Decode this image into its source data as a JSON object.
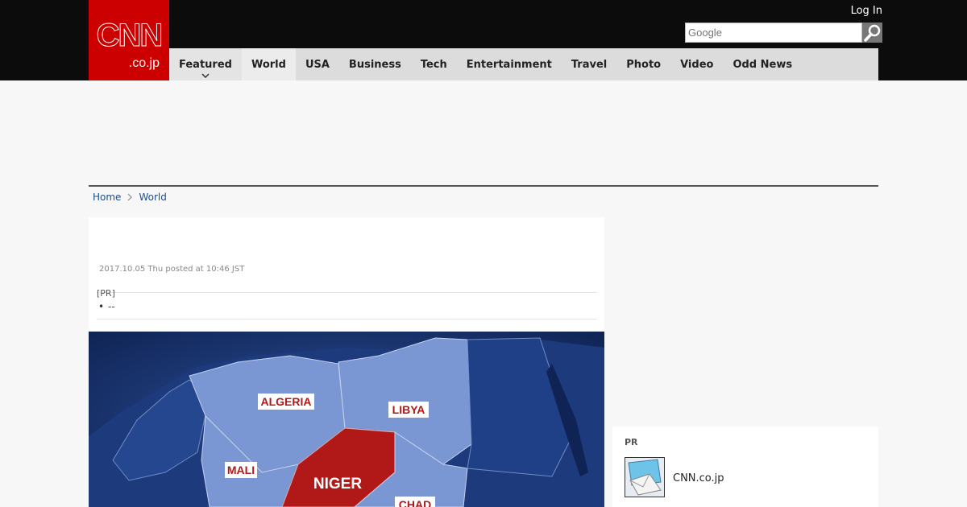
{
  "header": {
    "logo_main": "CNN",
    "logo_sub": ".co.jp",
    "login_label": "Log In",
    "search_placeholder": "Google",
    "brand_color": "#cc0000"
  },
  "nav": {
    "items": [
      {
        "label": "Featured"
      },
      {
        "label": "World"
      },
      {
        "label": "USA"
      },
      {
        "label": "Business"
      },
      {
        "label": "Tech"
      },
      {
        "label": "Entertainment"
      },
      {
        "label": "Travel"
      },
      {
        "label": "Photo"
      },
      {
        "label": "Video"
      },
      {
        "label": "Odd News"
      }
    ]
  },
  "breadcrumb": {
    "home": "Home",
    "current": "World"
  },
  "article": {
    "posted": "2017.10.05 Thu posted at 10:46 JST",
    "pr_label": "[PR]",
    "pr_link": "--",
    "map_labels": {
      "algeria": "ALGERIA",
      "libya": "LIBYA",
      "mali": "MALI",
      "niger": "NIGER",
      "chad": "CHAD"
    }
  },
  "sidebar": {
    "pr_label": "PR",
    "item_name": "CNN.co.jp"
  }
}
